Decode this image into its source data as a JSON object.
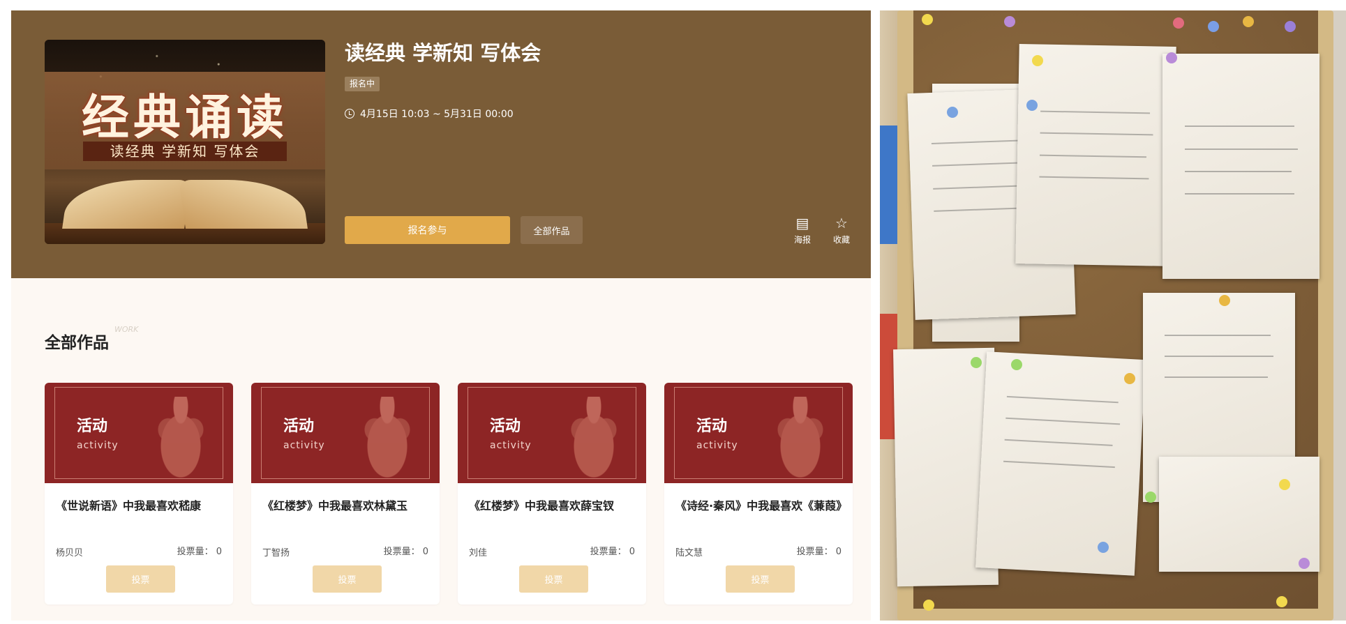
{
  "event": {
    "title": "读经典 学新知 写体会",
    "status": "报名中",
    "time": "4月15日 10:03 ~ 5月31日 00:00",
    "cover": {
      "headline": "经典诵读",
      "subtitle": "读经典 学新知 写体会"
    },
    "join_label": "报名参与",
    "all_works_label": "全部作品",
    "actions": [
      {
        "label": "海报",
        "icon": "poster-icon"
      },
      {
        "label": "收藏",
        "icon": "star-icon"
      }
    ]
  },
  "works_section": {
    "title": "全部作品",
    "title_en": "WORK"
  },
  "works": [
    {
      "banner_zh": "活动",
      "banner_en": "activity",
      "title": "《世说新语》中我最喜欢嵇康",
      "author": "杨贝贝",
      "votes": "投票量： 0",
      "vote_label": "投票"
    },
    {
      "banner_zh": "活动",
      "banner_en": "activity",
      "title": "《红楼梦》中我最喜欢林黛玉",
      "author": "丁智扬",
      "votes": "投票量： 0",
      "vote_label": "投票"
    },
    {
      "banner_zh": "活动",
      "banner_en": "activity",
      "title": "《红楼梦》中我最喜欢薛宝钗",
      "author": "刘佳",
      "votes": "投票量： 0",
      "vote_label": "投票"
    },
    {
      "banner_zh": "活动",
      "banner_en": "activity",
      "title": "《诗经·秦风》中我最喜欢《蒹葭》",
      "author": "陆文慧",
      "votes": "投票量： 0",
      "vote_label": "投票"
    }
  ],
  "colors": {
    "hero_bg": "#7a5c37",
    "accent": "#e1a94a",
    "card_banner": "#8d2525",
    "vote_button": "#f1d7a8"
  }
}
